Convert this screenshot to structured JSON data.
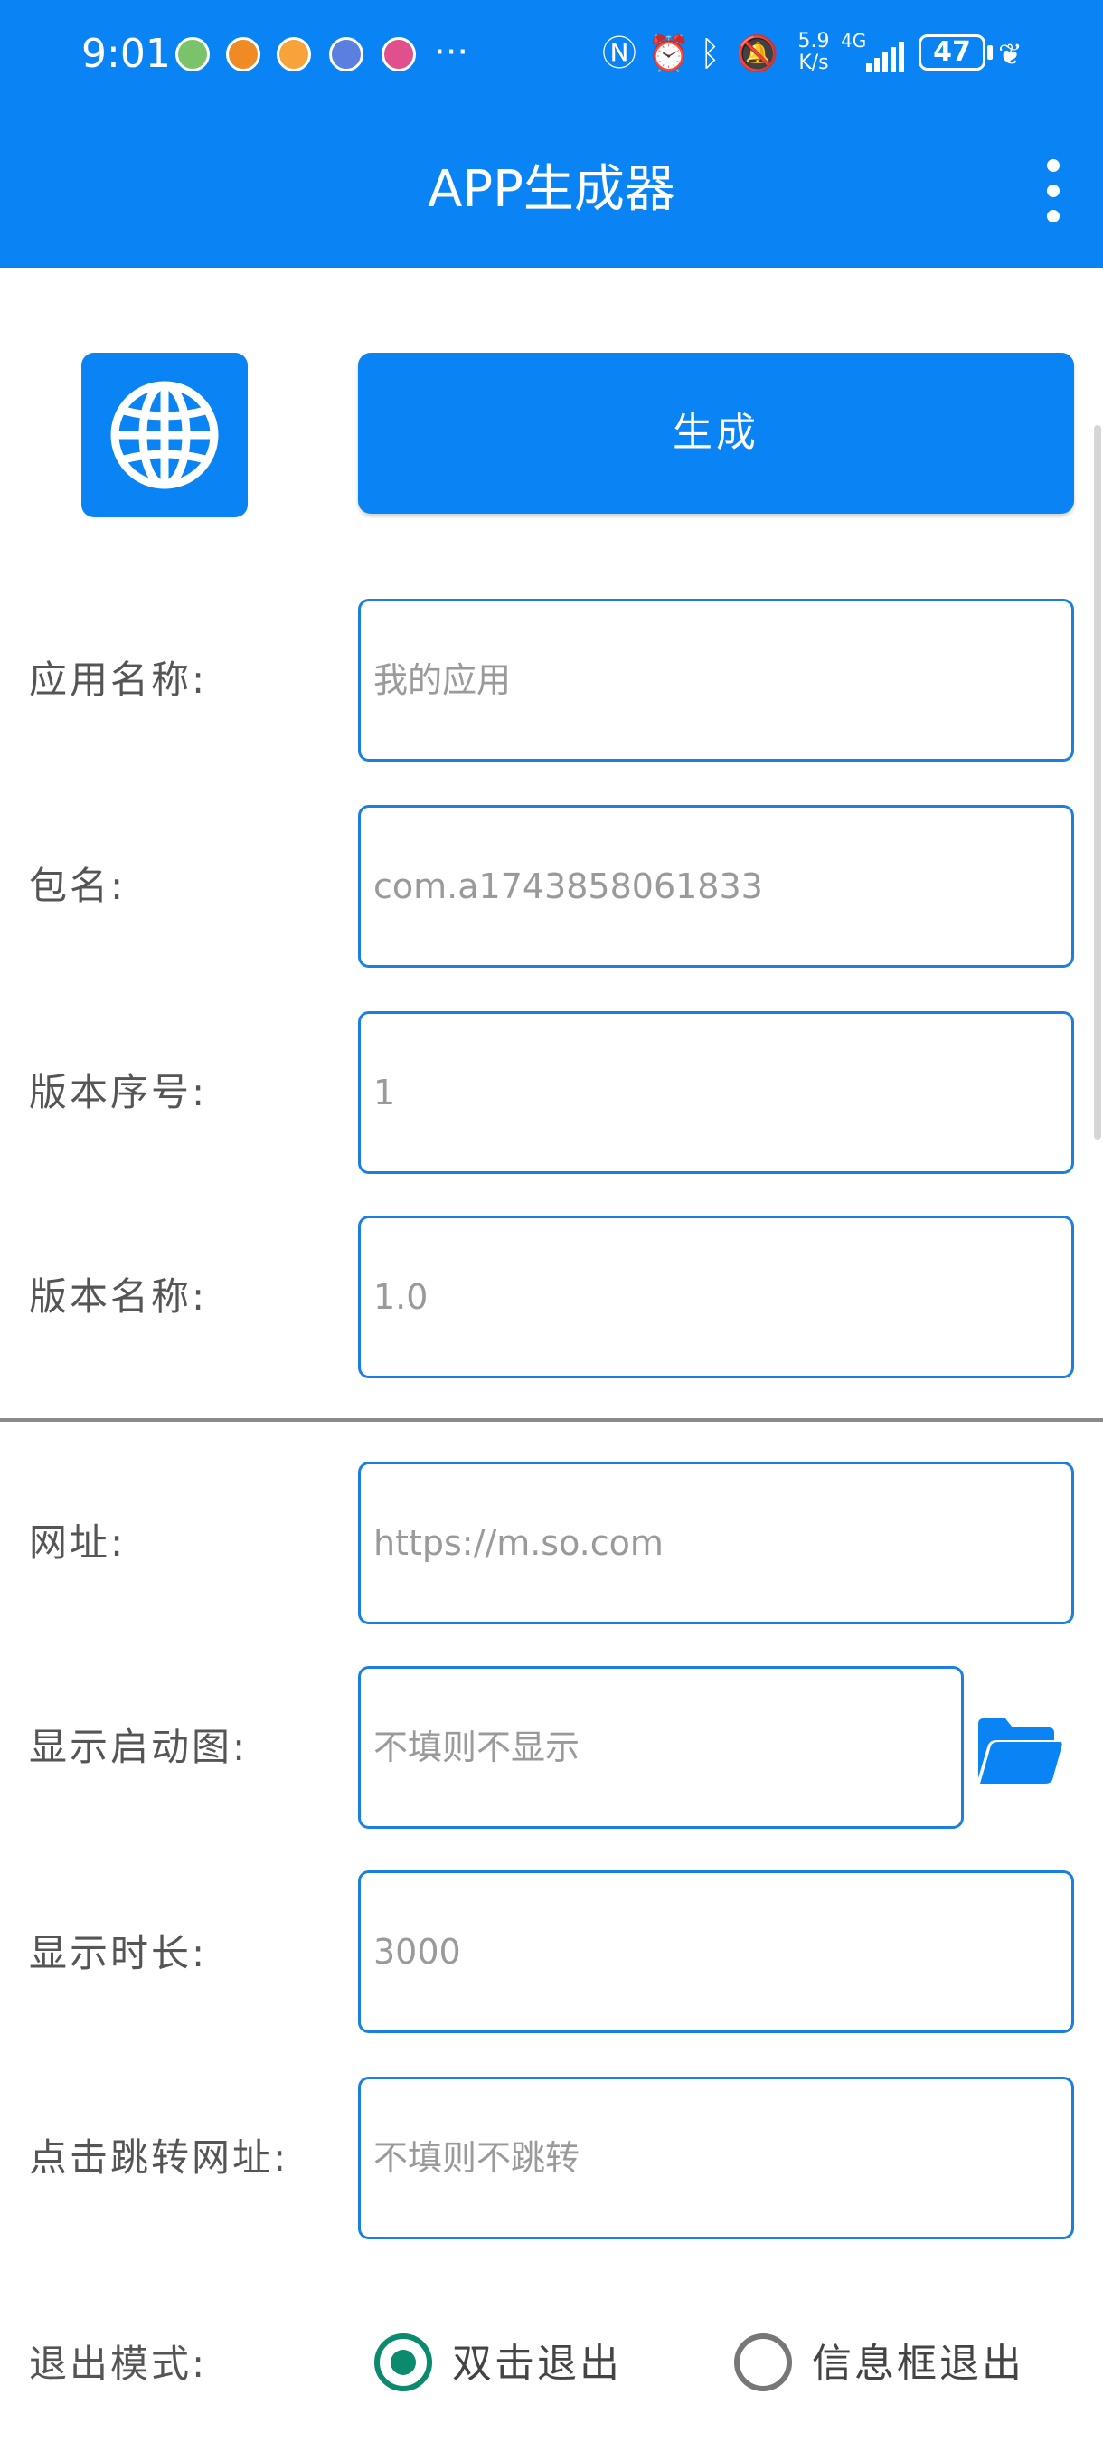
{
  "status_bar": {
    "time": "9:01",
    "more": "···",
    "net_speed_value": "5.9",
    "net_speed_unit": "K/s",
    "network_type": "4G",
    "battery": "47"
  },
  "app_bar": {
    "title": "APP生成器"
  },
  "generate_button": "生成",
  "fields": {
    "app_name": {
      "label": "应用名称:",
      "placeholder": "我的应用"
    },
    "package": {
      "label": "包名:",
      "placeholder": "com.a1743858061833"
    },
    "version_code": {
      "label": "版本序号:",
      "placeholder": "1"
    },
    "version_name": {
      "label": "版本名称:",
      "placeholder": "1.0"
    },
    "url": {
      "label": "网址:",
      "placeholder": "https://m.so.com"
    },
    "splash": {
      "label": "显示启动图:",
      "placeholder": "不填则不显示"
    },
    "duration": {
      "label": "显示时长:",
      "placeholder": "3000"
    },
    "click_url": {
      "label": "点击跳转网址:",
      "placeholder": "不填则不跳转"
    }
  },
  "exit_mode": {
    "label": "退出模式:",
    "options": [
      "双击退出",
      "信息框退出"
    ],
    "selected": "双击退出"
  },
  "colors": {
    "primary": "#0a84f5",
    "field_border": "#1a7fe0",
    "radio_selected": "#0b8a6e"
  },
  "icons": [
    "globe-icon",
    "folder-icon",
    "more-vert-icon"
  ]
}
